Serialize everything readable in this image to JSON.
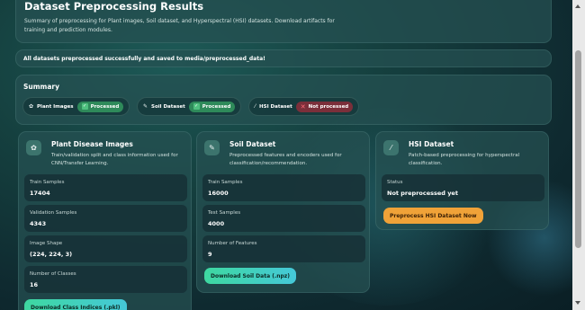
{
  "header": {
    "title": "Dataset Preprocessing Results",
    "description": "Summary of preprocessing for Plant images, Soil dataset, and Hyperspectral (HSI) datasets. Download artifacts for training and prediction modules."
  },
  "alert": {
    "message": "All datasets preprocessed successfully and saved to media/preprocessed_data!"
  },
  "summary": {
    "title": "Summary",
    "items": [
      {
        "icon": "leaf-icon",
        "glyph": "✿",
        "label": "Plant Images",
        "status": "Processed",
        "state": "ok"
      },
      {
        "icon": "pencil-icon",
        "glyph": "✎",
        "label": "Soil Dataset",
        "status": "Processed",
        "state": "ok"
      },
      {
        "icon": "brush-icon",
        "glyph": "⁄",
        "label": "HSI Dataset",
        "status": "Not processed",
        "state": "bad"
      }
    ]
  },
  "cards": {
    "plant": {
      "icon": "leaf-icon",
      "title": "Plant Disease Images",
      "description": "Train/validation split and class information used for CNN/Transfer Learning.",
      "stats": [
        {
          "label": "Train Samples",
          "value": "17404"
        },
        {
          "label": "Validation Samples",
          "value": "4343"
        },
        {
          "label": "Image Shape",
          "value": "(224, 224, 3)"
        },
        {
          "label": "Number of Classes",
          "value": "16"
        }
      ],
      "button": "Download Class Indices (.pkl)"
    },
    "soil": {
      "icon": "pencil-icon",
      "title": "Soil Dataset",
      "description": "Preprocessed features and encoders used for classification/recommendation.",
      "stats": [
        {
          "label": "Train Samples",
          "value": "16000"
        },
        {
          "label": "Test Samples",
          "value": "4000"
        },
        {
          "label": "Number of Features",
          "value": "9"
        }
      ],
      "button": "Download Soil Data (.npz)"
    },
    "hsi": {
      "icon": "brush-icon",
      "title": "HSI Dataset",
      "description": "Patch-based preprocessing for hyperspectral classification.",
      "stats": [
        {
          "label": "Status",
          "value": "Not preprocessed yet"
        }
      ],
      "button": "Preprocess HSI Dataset Now"
    }
  },
  "colors": {
    "accent_green": "#3ed8a0",
    "accent_orange": "#f0a238",
    "badge_ok": "#2e8a5a",
    "badge_bad": "#7b2f3a"
  }
}
